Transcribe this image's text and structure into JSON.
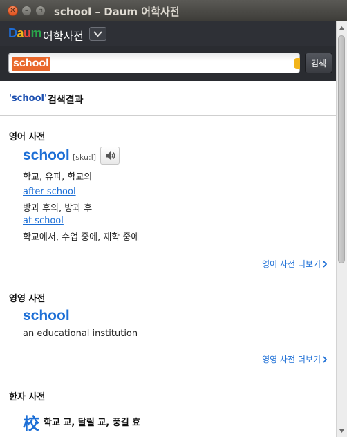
{
  "window": {
    "title": "school – Daum 어학사전"
  },
  "app": {
    "logo": [
      "D",
      "a",
      "u",
      "m"
    ],
    "logo_colors": [
      "#1e6dd6",
      "#f2b41b",
      "#e9463b",
      "#2aa54a"
    ],
    "title": "어학사전"
  },
  "search": {
    "value": "school",
    "button_label": "검색"
  },
  "result": {
    "query": "'school'",
    "label": "검색결과"
  },
  "eng_dict": {
    "title": "영어 사전",
    "word": "school",
    "pronunciation": "[sku:l]",
    "meaning": "학교, 유파, 학교의",
    "phrases": [
      {
        "text": "after school",
        "meaning": "방과 후의, 방과 후"
      },
      {
        "text": "at school",
        "meaning": "학교에서, 수업 중에, 재학 중에"
      }
    ],
    "more": "영어 사전 더보기"
  },
  "eng_eng_dict": {
    "title": "영영 사전",
    "word": "school",
    "meaning": "an educational institution",
    "more": "영영 사전 더보기"
  },
  "hanja_dict": {
    "title": "한자 사전",
    "char": "校",
    "meaning": "학교 교, 달릴 교, 풍길 효"
  },
  "colors": {
    "accent": "#1d6fd6",
    "selection": "#e9682c",
    "header": "#2e3036"
  }
}
